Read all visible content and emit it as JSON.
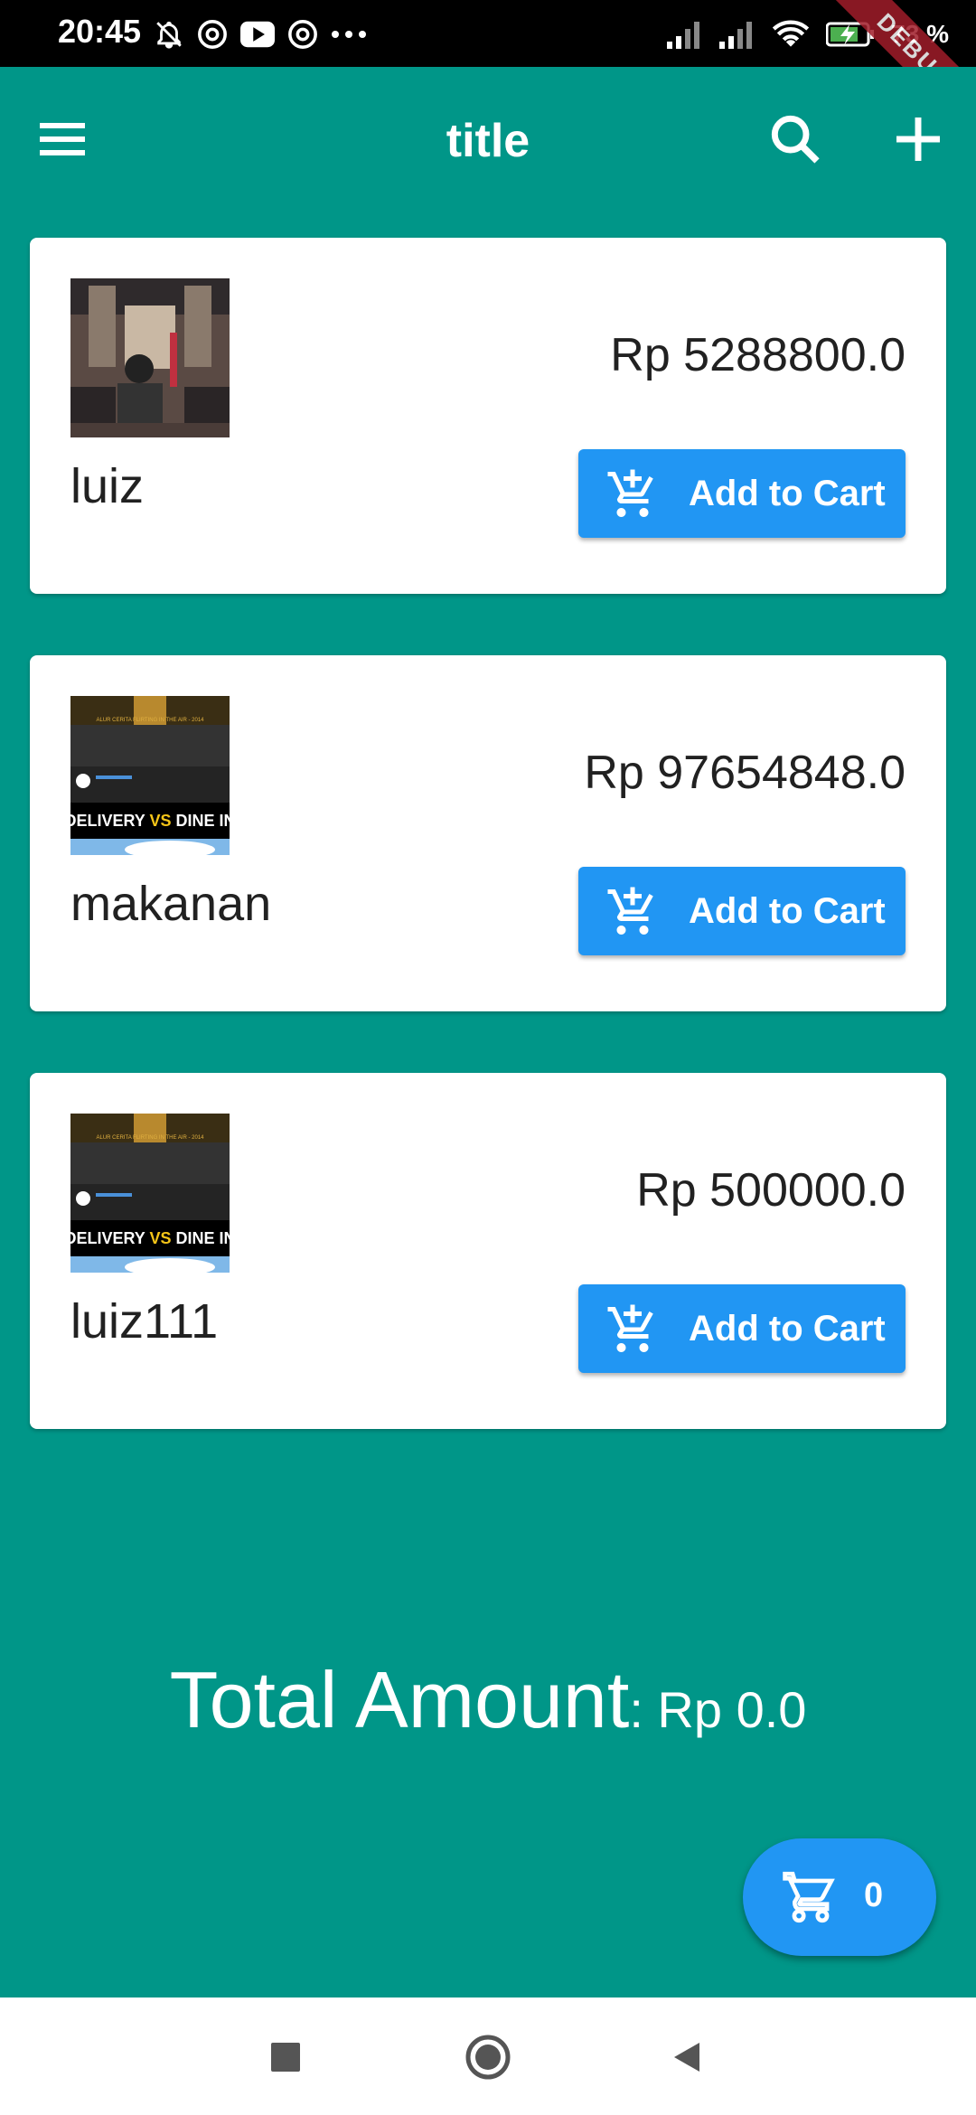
{
  "status_bar": {
    "time": "20:45",
    "battery_text": "73 %",
    "debug_banner": "DEBUG"
  },
  "app_bar": {
    "title": "title",
    "menu_icon": "menu-icon",
    "search_icon": "search-icon",
    "add_icon": "add-icon"
  },
  "products": [
    {
      "name": "luiz",
      "price": "Rp 5288800.0",
      "button_label": "Add to Cart"
    },
    {
      "name": "makanan",
      "price": "Rp 97654848.0",
      "button_label": "Add to Cart"
    },
    {
      "name": "luiz111",
      "price": "Rp 500000.0",
      "button_label": "Add to Cart"
    }
  ],
  "thumbnail_text": {
    "banner": "ALUR CERITA FLIRTING IN THE AIR - 2014",
    "caption": "DELIVERY VS DINE IN",
    "delivery": "DELIVERY",
    "vs": "VS",
    "dine_in": "DINE IN"
  },
  "total": {
    "label": "Total Amount",
    "value": ": Rp 0.0"
  },
  "cart_fab": {
    "count": "0"
  },
  "colors": {
    "background": "#009688",
    "button": "#2196f3",
    "card": "#ffffff"
  }
}
